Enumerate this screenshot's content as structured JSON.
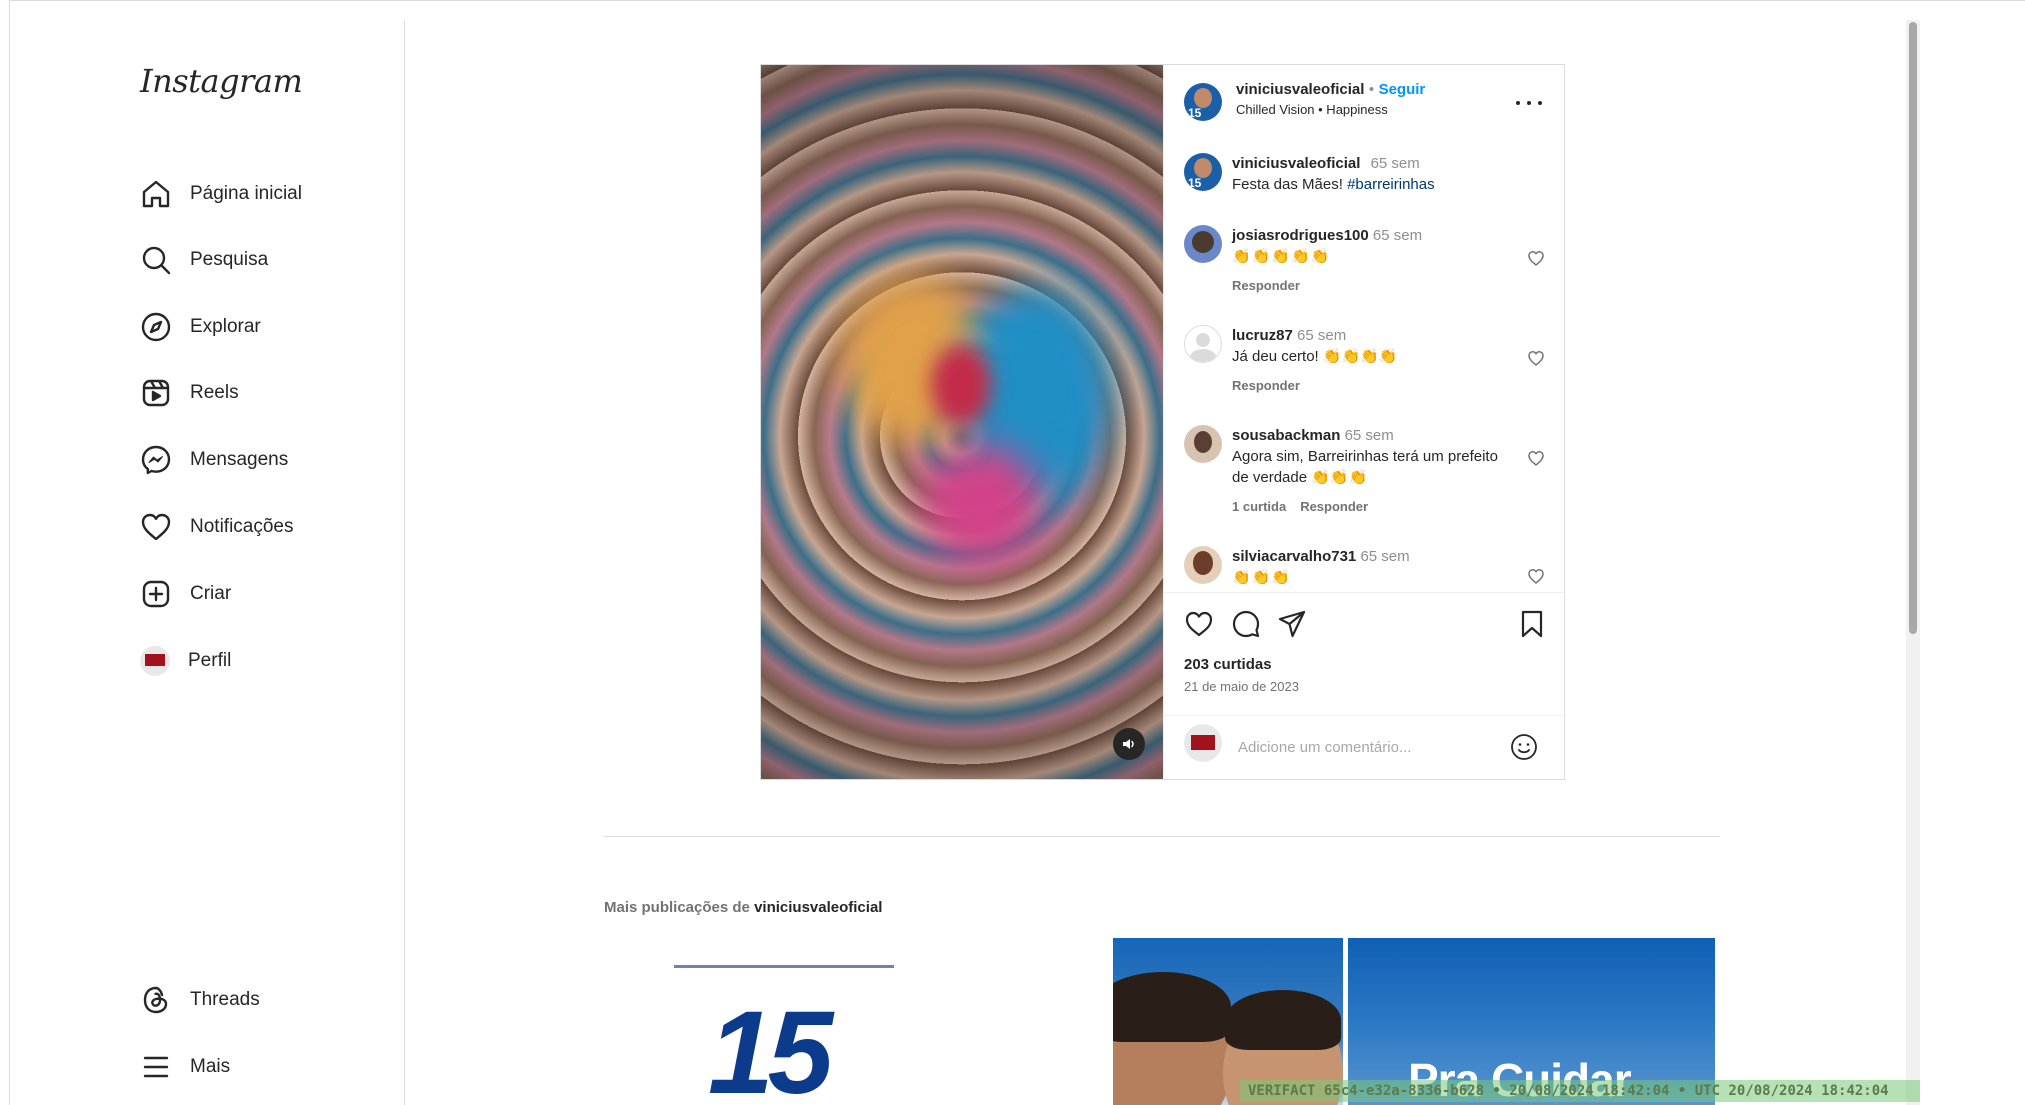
{
  "sidebar": {
    "logo": "Instagram",
    "nav": [
      {
        "label": "Página inicial",
        "icon": "home-icon"
      },
      {
        "label": "Pesquisa",
        "icon": "search-icon"
      },
      {
        "label": "Explorar",
        "icon": "compass-icon"
      },
      {
        "label": "Reels",
        "icon": "reels-icon"
      },
      {
        "label": "Mensagens",
        "icon": "messenger-icon"
      },
      {
        "label": "Notificações",
        "icon": "heart-icon"
      },
      {
        "label": "Criar",
        "icon": "plus-square-icon"
      },
      {
        "label": "Perfil",
        "icon": "profile-avatar-icon"
      }
    ],
    "bottom": [
      {
        "label": "Threads",
        "icon": "threads-icon"
      },
      {
        "label": "Mais",
        "icon": "menu-icon"
      }
    ]
  },
  "post": {
    "header": {
      "username": "viniciusvaleoficial",
      "separator": "•",
      "follow_label": "Seguir",
      "audio": "Chilled Vision • Happiness"
    },
    "caption": {
      "username": "viniciusvaleoficial",
      "time": "65 sem",
      "text": "Festa das Mães! ",
      "hashtag": "#barreirinhas"
    },
    "comments": [
      {
        "username": "josiasrodrigues100",
        "time": "65 sem",
        "text": "👏👏👏👏👏",
        "likes": "",
        "reply": "Responder"
      },
      {
        "username": "lucruz87",
        "time": "65 sem",
        "text": "Já deu certo! 👏👏👏👏",
        "likes": "",
        "reply": "Responder"
      },
      {
        "username": "sousabackman",
        "time": "65 sem",
        "text": "Agora sim, Barreirinhas terá um prefeito de verdade 👏👏👏",
        "likes": "1 curtida",
        "reply": "Responder"
      },
      {
        "username": "silviacarvalho731",
        "time": "65 sem",
        "text": "👏👏👏",
        "likes": "",
        "reply": ""
      }
    ],
    "likes": "203 curtidas",
    "date": "21 de maio de 2023",
    "comment_placeholder": "Adicione um comentário..."
  },
  "more": {
    "prefix": "Mais publicações de ",
    "username": "viniciusvaleoficial",
    "thumbs": [
      {
        "text": "15"
      },
      {
        "text": ""
      },
      {
        "text": "Pra Cuidar"
      }
    ]
  },
  "overlay": {
    "stamp": "VERIFACT 65c4-e32a-8336-b628 • 20/08/2024 18:42:04 • UTC 20/08/2024 18:42:04"
  },
  "colors": {
    "accent": "#0095f6",
    "text": "#262626",
    "muted": "#8e8e8e",
    "border": "#dbdbdb"
  }
}
